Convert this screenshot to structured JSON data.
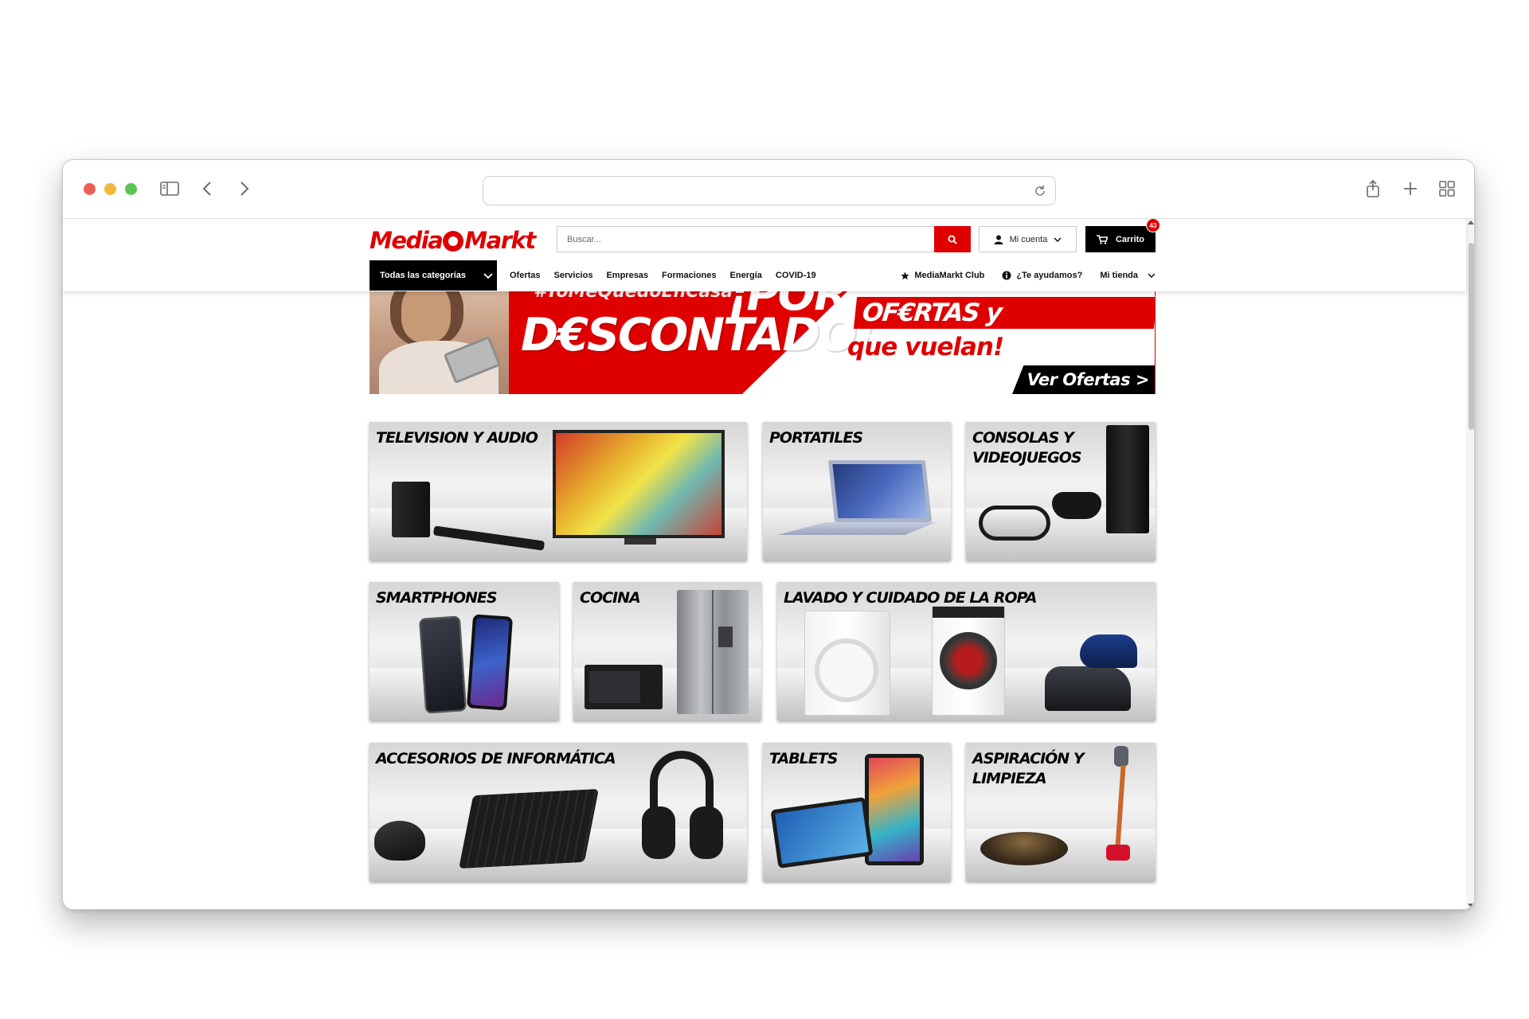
{
  "browser": {
    "url": "",
    "icons": [
      "sidebar-icon",
      "back-arrow-icon",
      "forward-arrow-icon",
      "reload-icon",
      "share-icon",
      "new-tab-icon",
      "tab-overview-icon"
    ]
  },
  "header": {
    "logo_text": "MediaMarkt",
    "search_placeholder": "Buscar...",
    "account_label": "Mi cuenta",
    "cart_label": "Carrito",
    "cart_count": "43"
  },
  "nav": {
    "all_categories": "Todas las categorías",
    "links": [
      "Ofertas",
      "Servicios",
      "Empresas",
      "Formaciones",
      "Energía",
      "COVID-19"
    ],
    "club": "MediaMarkt Club",
    "help": "¿Te ayudamos?",
    "store": "Mi tienda"
  },
  "hero": {
    "hashtag": "#YoMeQuedoEnCasa",
    "headline_top": "¡POR",
    "headline": "D€SCONTADO!",
    "offers": "OF€RTAS y D€SCUENTOS",
    "subline": "que vuelan!",
    "cta": "Ver Ofertas >"
  },
  "categories": [
    {
      "title": "TELEVISION Y AUDIO"
    },
    {
      "title": "PORTATILES"
    },
    {
      "title": "CONSOLAS Y\nVIDEOJUEGOS"
    },
    {
      "title": "SMARTPHONES"
    },
    {
      "title": "COCINA"
    },
    {
      "title": "LAVADO Y CUIDADO DE LA ROPA"
    },
    {
      "title": "ACCESORIOS DE INFORMÁTICA"
    },
    {
      "title": "TABLETS"
    },
    {
      "title": "ASPIRACIÓN Y\nLIMPIEZA"
    }
  ],
  "colors": {
    "brand_red": "#df0000",
    "black": "#000000"
  }
}
